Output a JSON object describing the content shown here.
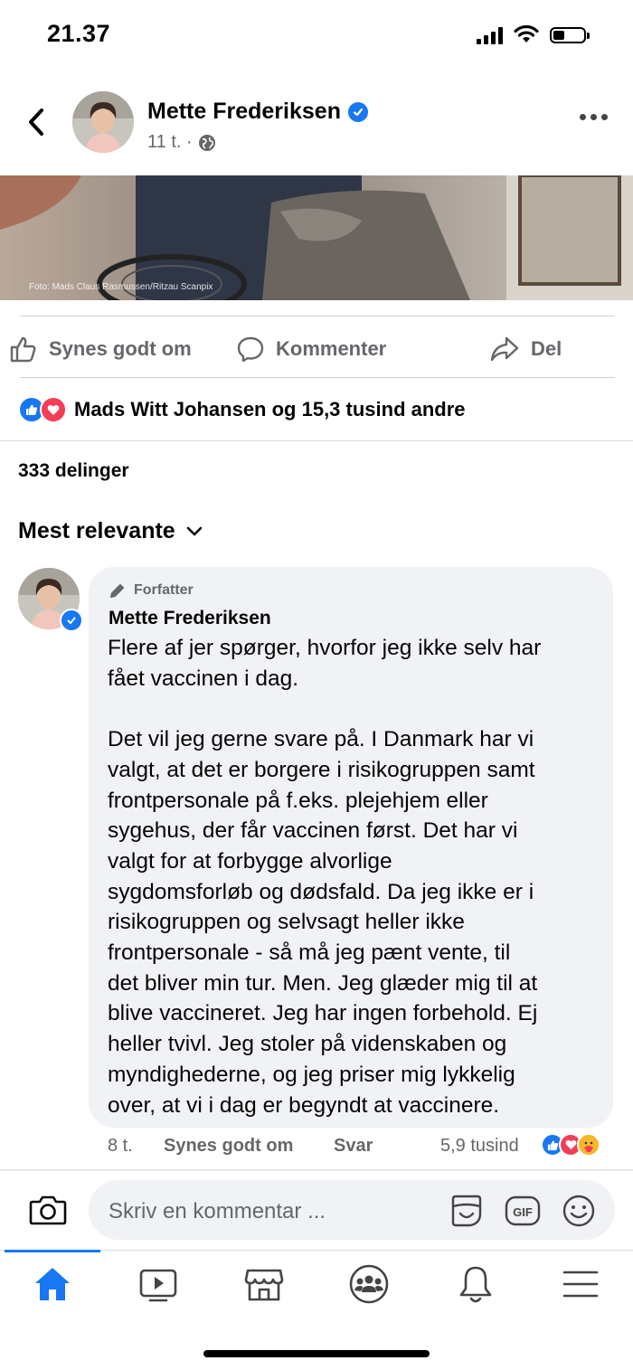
{
  "status_bar": {
    "time": "21.37"
  },
  "header": {
    "back_icon": "chevron-left-icon",
    "author_name": "Mette Frederiksen",
    "verified_icon": "verified-badge-icon",
    "post_time": "11 t. ·",
    "privacy_icon": "globe-icon",
    "more_icon": "more-icon"
  },
  "photo": {
    "credit": "Foto: Mads Claus Rasmussen/Ritzau Scanpix"
  },
  "actions": {
    "like": "Synes godt om",
    "comment": "Kommenter",
    "share": "Del"
  },
  "reactions": {
    "summary": "Mads Witt Johansen og 15,3 tusind andre"
  },
  "shares": "333 delinger",
  "sort": {
    "label": "Mest relevante"
  },
  "colors": {
    "accent": "#1877f2",
    "love": "#f33e58",
    "bubble": "#f0f2f5",
    "muted": "#65676b"
  },
  "comment": {
    "badge": "Forfatter",
    "author": "Mette Frederiksen",
    "text": "Flere af jer spørger, hvorfor jeg ikke selv har\nfået vaccinen i dag.\n\nDet vil jeg gerne svare på. I Danmark har vi\nvalgt, at det er borgere i risikogruppen samt\nfrontpersonale på f.eks. plejehjem eller\nsygehus, der får vaccinen først. Det har vi\nvalgt for at forbygge alvorlige\nsygdomsforløb og dødsfald. Da jeg ikke er i\nrisikogruppen og selvsagt heller ikke\nfrontpersonale - så må jeg pænt vente, til\ndet bliver min tur. Men. Jeg glæder mig til at\nblive vaccineret. Jeg har ingen forbehold. Ej\nheller tvivl. Jeg stoler på videnskaben og\nmyndighederne, og jeg priser mig lykkelig\nover, at vi i dag er begyndt at vaccinere.",
    "time": "8 t.",
    "like": "Synes godt om",
    "reply": "Svar",
    "reaction_count": "5,9 tusind"
  },
  "composer": {
    "placeholder": "Skriv en kommentar ..."
  },
  "nav": [
    "home-icon",
    "watch-icon",
    "marketplace-icon",
    "groups-icon",
    "notifications-icon",
    "menu-icon"
  ]
}
